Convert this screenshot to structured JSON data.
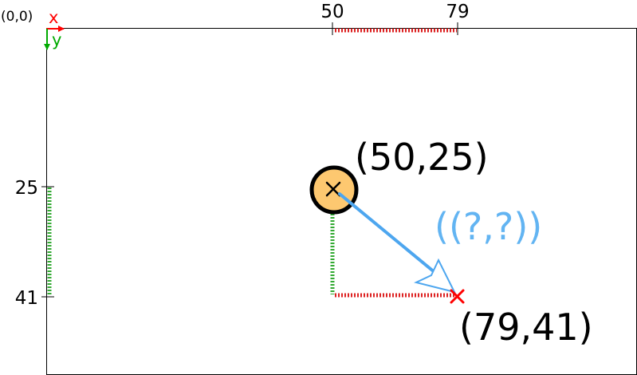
{
  "origin_label": "(0,0)",
  "axes": {
    "x_label": "x",
    "y_label": "y",
    "x_color": "#ff0000",
    "y_color": "#00aa00"
  },
  "x_ticks": [
    "50",
    "79"
  ],
  "y_ticks": [
    "25",
    "41"
  ],
  "start_point": {
    "label": "(50,25)",
    "x": 50,
    "y": 25,
    "fill_color": "#fdc870",
    "marker": "x-mark-icon"
  },
  "end_point": {
    "label": "(79,41)",
    "x": 79,
    "y": 41,
    "marker_color": "#ff0000",
    "marker": "x-mark-icon"
  },
  "vector": {
    "label": "((?,?))",
    "color": "#4da6ef"
  },
  "colors": {
    "dx_dashes": "#dd2222",
    "dy_dashes": "#33aa33",
    "frame": "#000000"
  }
}
